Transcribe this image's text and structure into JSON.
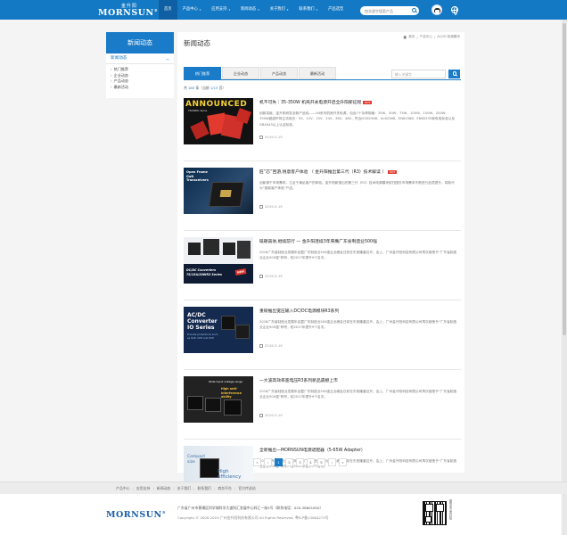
{
  "header": {
    "logo_cn": "金升阳",
    "logo_en": "MORNSUN",
    "logo_mark": "®",
    "nav": [
      {
        "label": "首页",
        "active": true,
        "caret": false
      },
      {
        "label": "产品中心",
        "active": false,
        "caret": true
      },
      {
        "label": "应用支持",
        "active": false,
        "caret": true
      },
      {
        "label": "新闻动态",
        "active": false,
        "caret": true
      },
      {
        "label": "关于我们",
        "active": false,
        "caret": true
      },
      {
        "label": "联系我们",
        "active": false,
        "caret": true
      },
      {
        "label": "产品选型",
        "active": false,
        "caret": false
      }
    ],
    "search_placeholder": "按关键字搜索产品"
  },
  "sidebar": {
    "title": "新闻动态",
    "sub_title": "新闻动态",
    "items": [
      "热门推荐",
      "企业动态",
      "产品动态",
      "最新活动"
    ]
  },
  "main": {
    "title": "新闻动态",
    "breadcrumb": [
      "首页",
      "产品中心",
      "AC/DC电源模块"
    ],
    "breadcrumb_sep": "/",
    "tabs": [
      "热门推荐",
      "企业动态",
      "产品动态",
      "最新活动"
    ],
    "active_tab": 0,
    "search_placeholder": "输入关键字",
    "count_prefix": "共",
    "count_total": "185",
    "count_unit": "条（当前",
    "count_page": "1/13",
    "count_suffix": "页）",
    "news": [
      {
        "title": "机不可失｜35-350W 机壳开关电源开启全升阳新征程",
        "hot": "HOT",
        "desc": "创新突破，金升阳研发全新产品线——LM系列机壳开关电源，包含7个功率规格：35W、50W、75W、100W、150W、200W、350W超越市场主流电压：5V、12V、15V、24V、36V、48V，符合IEC62368、UL62368、EN62368、EN60335家电电标准以及GB4943以上认证标准。",
        "date": "2019-3-19",
        "thumb_text": "ANNOUNCED",
        "thumb_sub": "TRI/NMBL Series"
      },
      {
        "title": "匠“芯”回游,锐意客户体验 （ 金升阳推出第三代（R3）技术解读 ）",
        "hot": "HOT",
        "desc": "创新源于市场需求，立足于满足客户的体验。金升阳新推出的第三代（R3）技术电源模块依托国外市场需求不断进行品质提升，将新代为“极致客户体验”产品。",
        "date": "2019-3-19",
        "thumb_text": "Open Frame GaN Transceivers",
        "thumb_sub": ""
      },
      {
        "title": "砥砺奋进,继续前行 — 金升阳连续3年荣膺广东省制造业500强",
        "hot": "",
        "desc": "2018广东省制造业发展年会暨广东制造业500强企业峰会日前在东莞隆重召开。会上，广州金升阳科技有限公司再次被授予“广东省制造业企业500强”称号，较2017年提升9个名次。",
        "date": "2019-3-19",
        "thumb_text": "DC/DC Converters 7S/15A/20WR3 Series",
        "thumb_sub": "NEW"
      },
      {
        "title": "重磅推出宽压输入DC/DC电源模块R3系列",
        "hot": "",
        "desc": "2018广东省制造业发展年会暨广东制造业500强企业峰会日前在东莞隆重召开。会上，广州金升阳科技有限公司再次被授予“广东省制造业企业500强”称号，较2017年提升9个名次。",
        "date": "2019-3-19",
        "thumb_text": "AC/DC Converter IO Series",
        "thumb_sub": "Provide protections such as SCP, OCP and OVP"
      },
      {
        "title": "一大波高效率宽电压R3系列新品震撼上市",
        "hot": "",
        "desc": "2018广东省制造业发展年会暨广东制造业500强企业峰会日前在东莞隆重召开。会上，广州金升阳科技有限公司再次被授予“广东省制造业企业500强”称号，较2017年提升9个名次。",
        "date": "2019-3-19",
        "thumb_text": "Wide input voltage range",
        "thumb_sub": "High anti-interference ability"
      },
      {
        "title": "全新推出—MORNSUN电源适配器（5-65W Adapter）",
        "hot": "",
        "desc": "2018广东省制造业发展年会暨广东制造业500强企业峰会日前在东莞隆重召开。会上，广州金升阳科技有限公司再次被授予“广东省制造业企业500强”称号，较2017年提升9个名次。",
        "date": "2019-3-19",
        "thumb_text": "Compact size",
        "thumb_sub": "High efficiency"
      }
    ],
    "pagination": [
      "«",
      "‹",
      "1",
      "2",
      "3",
      "4",
      "5",
      "›",
      "»"
    ],
    "active_page": "1"
  },
  "footer": {
    "links": [
      "产品中心",
      "应用支持",
      "新闻动态",
      "关于我们",
      "联系我们",
      "商务平台",
      "官方传送站"
    ],
    "logo": "MORNSUN",
    "logo_mark": "®",
    "address": "广东省广州市黄埔区科学城科学大道科汇发展中心科汇一街5号（联系电话：020-38601850）",
    "copyright": "Copyright © 2009-2019 广州金升阳科技有限公司 All Rights Reserved. 粤ICP备13064273号",
    "qr_label": "微信关注金升阳"
  },
  "colors": {
    "primary": "#1479c4",
    "hot": "#e23a2e"
  }
}
